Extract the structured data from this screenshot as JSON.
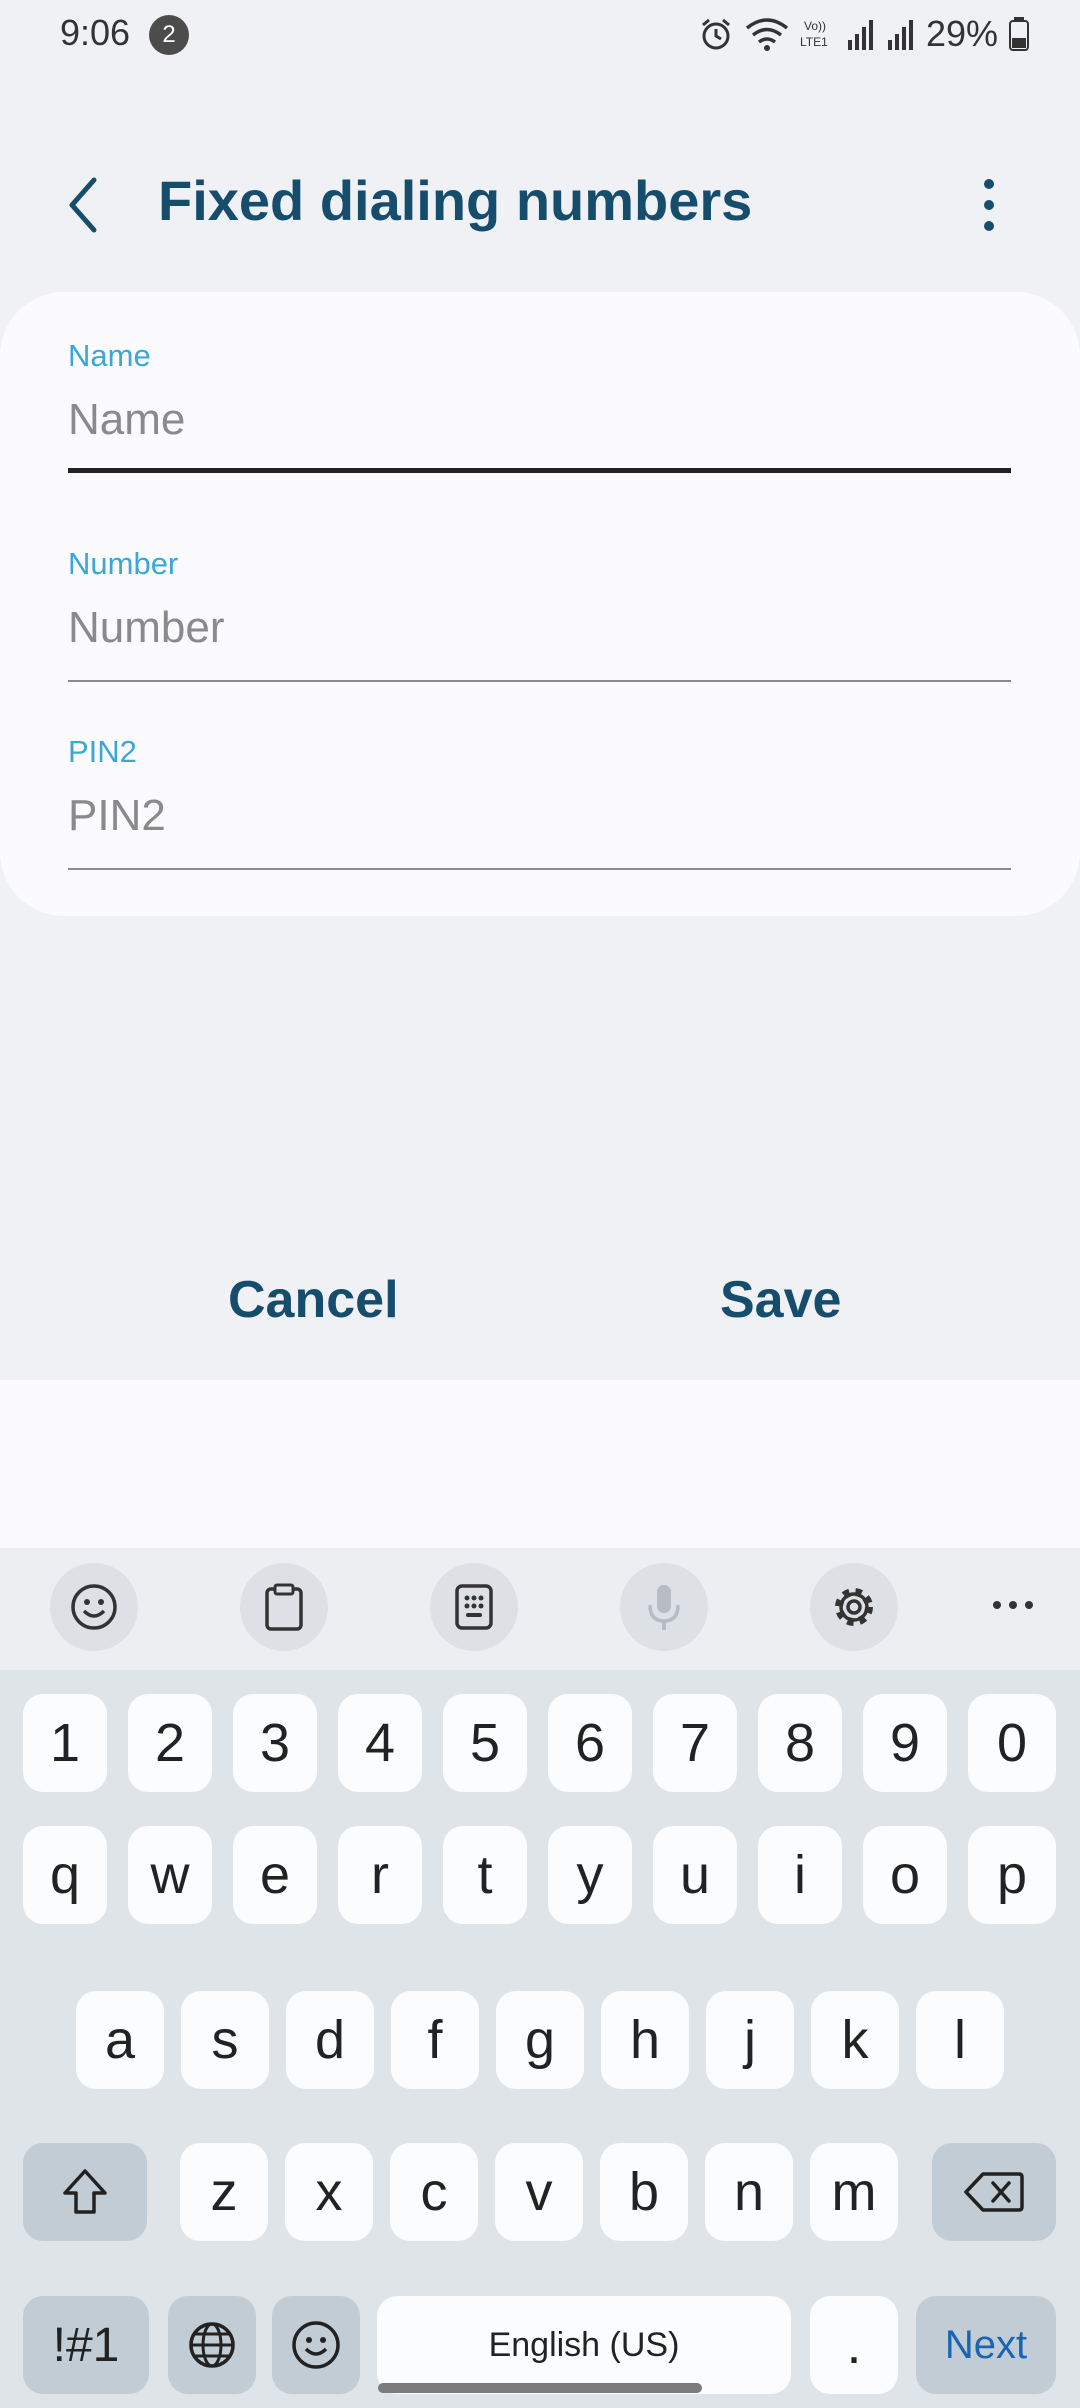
{
  "status": {
    "time": "9:06",
    "notif_count": "2",
    "battery": "29%"
  },
  "header": {
    "title": "Fixed dialing numbers"
  },
  "form": {
    "name": {
      "label": "Name",
      "placeholder": "Name",
      "value": ""
    },
    "number": {
      "label": "Number",
      "placeholder": "Number",
      "value": ""
    },
    "pin2": {
      "label": "PIN2",
      "placeholder": "PIN2",
      "value": ""
    }
  },
  "actions": {
    "cancel": "Cancel",
    "save": "Save"
  },
  "keyboard": {
    "toolbar_icons": [
      "emoji-icon",
      "clipboard-icon",
      "keypad-icon",
      "microphone-icon",
      "settings-icon",
      "more-icon"
    ],
    "row1": [
      "1",
      "2",
      "3",
      "4",
      "5",
      "6",
      "7",
      "8",
      "9",
      "0"
    ],
    "row2": [
      "q",
      "w",
      "e",
      "r",
      "t",
      "y",
      "u",
      "i",
      "o",
      "p"
    ],
    "row3": [
      "a",
      "s",
      "d",
      "f",
      "g",
      "h",
      "j",
      "k",
      "l"
    ],
    "row4": [
      "z",
      "x",
      "c",
      "v",
      "b",
      "n",
      "m"
    ],
    "symbols_label": "!#1",
    "space_label": "English (US)",
    "period_label": ".",
    "next_label": "Next"
  }
}
